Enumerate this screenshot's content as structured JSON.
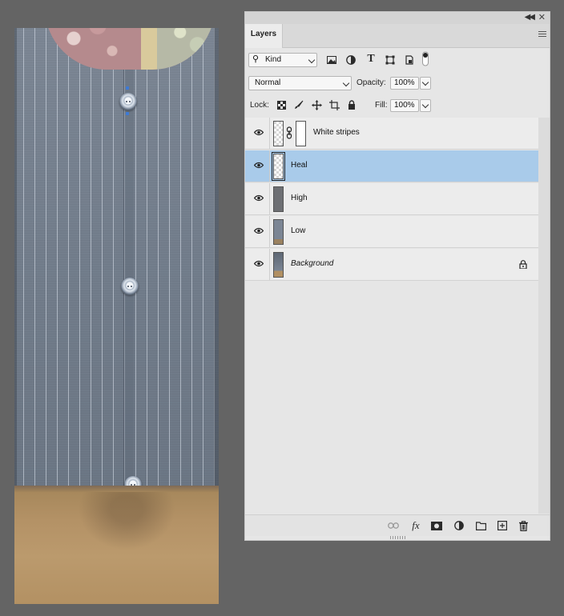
{
  "panel": {
    "tab_label": "Layers"
  },
  "filter": {
    "kind_label": "Kind",
    "icons": [
      "image-filter-icon",
      "adjustment-filter-icon",
      "type-filter-icon",
      "shape-filter-icon",
      "smart-object-filter-icon",
      "filter-toggle-icon"
    ]
  },
  "blend": {
    "mode": "Normal",
    "opacity_label": "Opacity:",
    "opacity_value": "100%"
  },
  "lock": {
    "label": "Lock:",
    "fill_label": "Fill:",
    "fill_value": "100%",
    "icons": [
      "lock-transparent-pixels-icon",
      "lock-image-pixels-icon",
      "lock-position-icon",
      "lock-artboard-icon",
      "lock-all-icon"
    ]
  },
  "layers": [
    {
      "name": "White stripes",
      "selected": false,
      "italic": false,
      "has_mask": true,
      "locked": false
    },
    {
      "name": "Heal",
      "selected": true,
      "italic": false,
      "has_mask": false,
      "locked": false
    },
    {
      "name": "High",
      "selected": false,
      "italic": false,
      "has_mask": false,
      "locked": false
    },
    {
      "name": "Low",
      "selected": false,
      "italic": false,
      "has_mask": false,
      "locked": false
    },
    {
      "name": "Background",
      "selected": false,
      "italic": true,
      "has_mask": false,
      "locked": true
    }
  ],
  "bottom_icons": [
    "link-layers-icon",
    "fx-icon",
    "add-mask-icon",
    "adjustment-layer-icon",
    "new-group-icon",
    "new-layer-icon",
    "delete-layer-icon"
  ],
  "colors": {
    "selected_row": "#a9cbea",
    "panel_bg": "#e6e6e6",
    "workspace_bg": "#646464"
  }
}
